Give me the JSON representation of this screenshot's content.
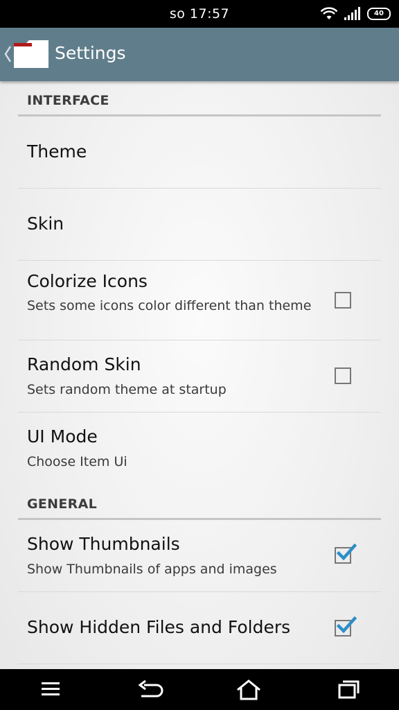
{
  "status_bar": {
    "time": "so 17:57",
    "battery": "40",
    "icons": [
      "wifi-icon",
      "signal-icon",
      "battery-icon"
    ]
  },
  "app_bar": {
    "title": "Settings",
    "color": "#607d8b"
  },
  "sections": [
    {
      "label": "INTERFACE",
      "items": [
        {
          "title": "Theme"
        },
        {
          "title": "Skin"
        },
        {
          "title": "Colorize Icons",
          "summary": "Sets some icons color different than theme",
          "checked": false
        },
        {
          "title": "Random Skin",
          "summary": "Sets random theme at startup",
          "checked": false
        },
        {
          "title": "UI Mode",
          "summary": "Choose Item Ui"
        }
      ]
    },
    {
      "label": "GENERAL",
      "items": [
        {
          "title": "Show Thumbnails",
          "summary": "Show Thumbnails of apps and images",
          "checked": true
        },
        {
          "title": "Show Hidden Files and Folders",
          "checked": true
        }
      ]
    }
  ],
  "nav_bar": {
    "buttons": [
      "menu-icon",
      "back-icon",
      "home-icon",
      "recents-icon"
    ]
  },
  "colors": {
    "checkmark": "#2b8fc8",
    "divider": "#c5c5c5"
  }
}
